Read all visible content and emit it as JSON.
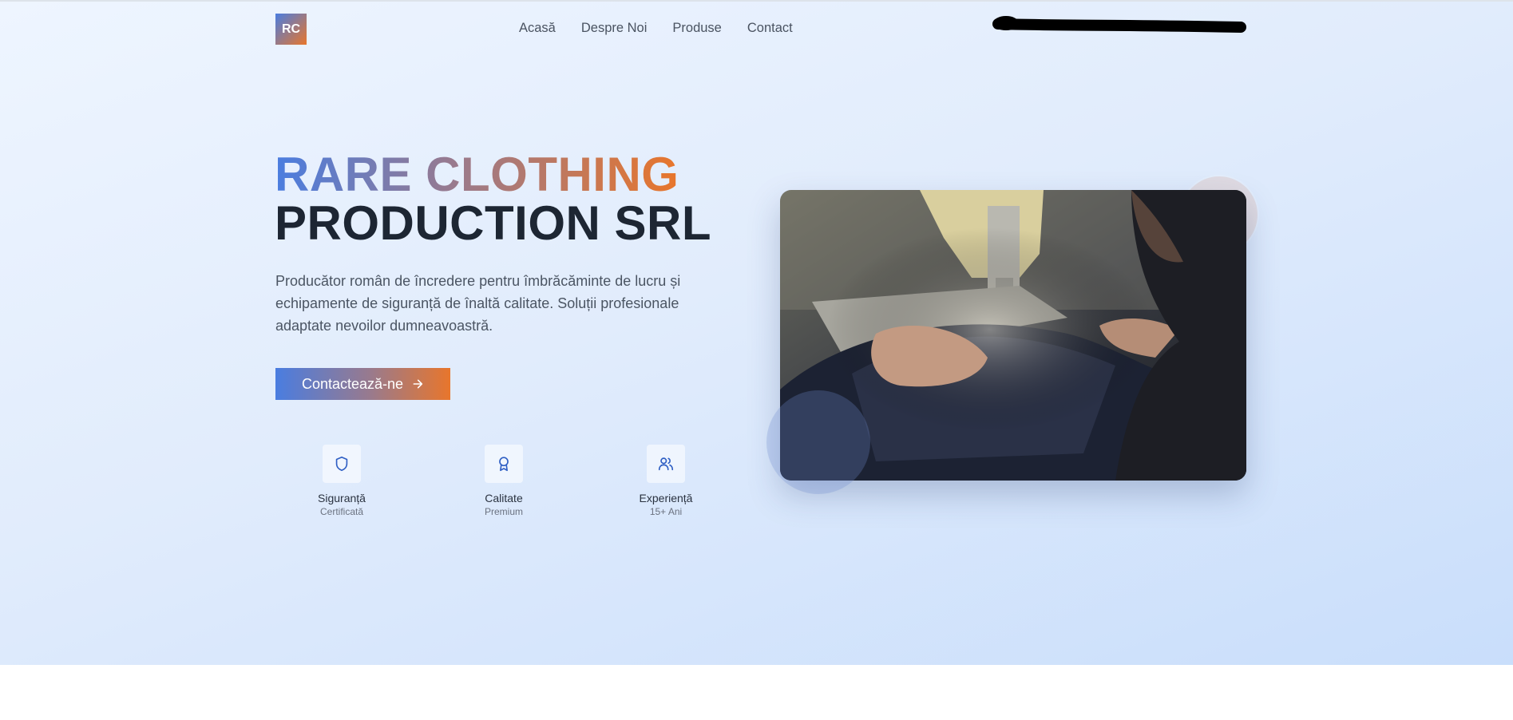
{
  "header": {
    "logo_text": "RC",
    "nav": [
      "Acasă",
      "Despre Noi",
      "Produse",
      "Contact"
    ]
  },
  "hero": {
    "title_line1": "RARE CLOTHING",
    "title_line2": "PRODUCTION SRL",
    "description": "Producător român de încredere pentru îmbrăcăminte de lucru și echipamente de siguranță de înaltă calitate. Soluții profesionale adaptate nevoilor dumneavoastră.",
    "cta_label": "Contactează-ne",
    "cta_icon": "arrow-right-icon"
  },
  "features": [
    {
      "label": "Siguranță",
      "sub": "Certificată",
      "icon": "shield-icon"
    },
    {
      "label": "Calitate",
      "sub": "Premium",
      "icon": "award-icon"
    },
    {
      "label": "Experiență",
      "sub": "15+ Ani",
      "icon": "users-icon"
    }
  ],
  "image": {
    "alt": "sewing-machine-photo"
  },
  "colors": {
    "accent_blue": "#4a7de0",
    "accent_orange": "#e8762c",
    "title_dark": "#1d2633",
    "icon_blue": "#2f5fc4"
  }
}
